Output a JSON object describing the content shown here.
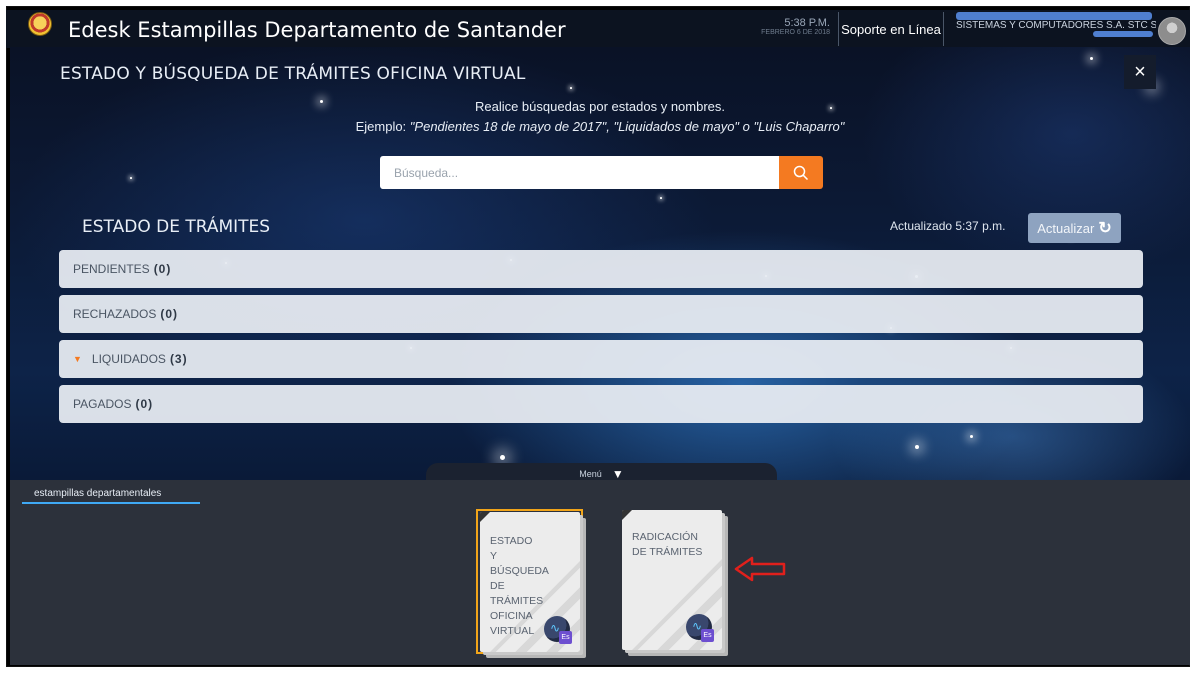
{
  "app": {
    "title": "Edesk Estampillas Departamento de Santander",
    "time": "5:38 P.M.",
    "date": "FEBRERO 6 DE 2018",
    "support_label": "Soporte en Línea",
    "user_name": "SISTEMAS Y COMPUTADORES S.A. STC SA"
  },
  "panel": {
    "title": "ESTADO Y BÚSQUEDA DE TRÁMITES OFICINA VIRTUAL",
    "close_label": "×",
    "hint_line1": "Realice búsquedas por estados y nombres.",
    "hint_prefix": "Ejemplo: ",
    "hint_examples": "\"Pendientes 18 de mayo de 2017\", \"Liquidados de mayo\" o \"Luis Chaparro\"",
    "search_placeholder": "Búsqueda...",
    "section_title": "ESTADO DE TRÁMITES",
    "updated_text": "Actualizado 5:37 p.m.",
    "refresh_label": "Actualizar",
    "statuses": [
      {
        "label": "PENDIENTES",
        "count": "(0)",
        "expanded": false
      },
      {
        "label": "RECHAZADOS",
        "count": "(0)",
        "expanded": false
      },
      {
        "label": "LIQUIDADOS",
        "count": "(3)",
        "expanded": true
      },
      {
        "label": "PAGADOS",
        "count": "(0)",
        "expanded": false
      }
    ]
  },
  "menu": {
    "label": "Menú",
    "tab_label": "estampillas departamentales",
    "tiles": [
      {
        "label": "ESTADO Y BÚSQUEDA DE TRÁMITES OFICINA VIRTUAL",
        "selected": true,
        "icon": "es-app-icon"
      },
      {
        "label": "RADICACIÓN DE TRÁMITES",
        "selected": false,
        "icon": "es-app-icon"
      }
    ]
  },
  "colors": {
    "accent_orange": "#f47a21",
    "selected_border": "#f2a51a",
    "annotation_arrow": "#e0201c"
  }
}
